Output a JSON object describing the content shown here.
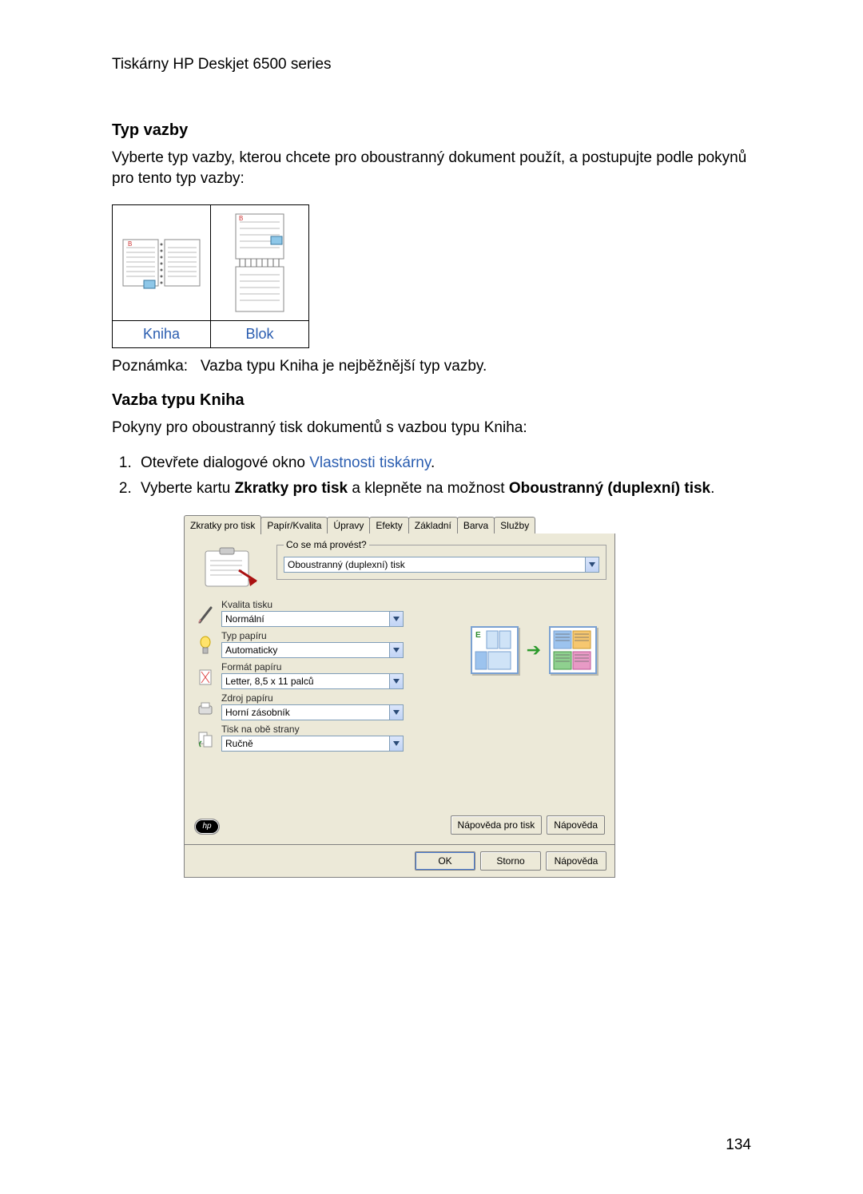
{
  "header": {
    "product": "Tiskárny HP Deskjet 6500 series"
  },
  "section1": {
    "heading": "Typ vazby",
    "body": "Vyberte typ vazby, kterou chcete pro oboustranný dokument použít, a postupujte podle pokynů pro tento typ vazby:"
  },
  "binding": {
    "book_label": "Kniha",
    "block_label": "Blok"
  },
  "note": {
    "prefix": "Poznámka:",
    "text": "Vazba typu Kniha je nejběžnější typ vazby."
  },
  "section2": {
    "heading": "Vazba typu Kniha",
    "intro": "Pokyny pro oboustranný tisk dokumentů s vazbou typu Kniha:",
    "step1_pre": "Otevřete dialogové okno ",
    "step1_link": "Vlastnosti tiskárny",
    "step1_post": ".",
    "step2_pre": "Vyberte kartu ",
    "step2_b1": "Zkratky pro tisk",
    "step2_mid": " a klepněte na možnost ",
    "step2_b2": "Oboustranný (duplexní) tisk",
    "step2_post": "."
  },
  "dialog": {
    "tabs": [
      "Zkratky pro tisk",
      "Papír/Kvalita",
      "Úpravy",
      "Efekty",
      "Základní",
      "Barva",
      "Služby"
    ],
    "group_title": "Co se má provést?",
    "task_value": "Oboustranný (duplexní) tisk",
    "opts": {
      "quality_label": "Kvalita tisku",
      "quality_value": "Normální",
      "papertype_label": "Typ papíru",
      "papertype_value": "Automaticky",
      "papersize_label": "Formát papíru",
      "papersize_value": "Letter, 8,5 x 11 palců",
      "source_label": "Zdroj papíru",
      "source_value": "Horní zásobník",
      "duplex_label": "Tisk na obě strany",
      "duplex_value": "Ručně"
    },
    "hp_logo": "hp",
    "inner_buttons": {
      "help_tip": "Nápověda pro tisk",
      "help": "Nápověda"
    },
    "outer_buttons": {
      "ok": "OK",
      "cancel": "Storno",
      "help": "Nápověda"
    }
  },
  "page_number": "134"
}
